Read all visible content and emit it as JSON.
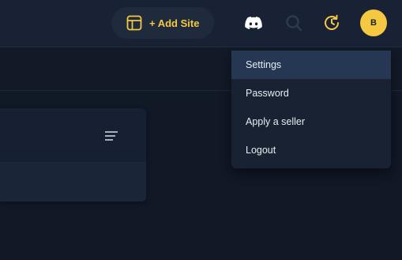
{
  "header": {
    "add_site_label": "+ Add Site",
    "avatar_initial": "B",
    "accent_color": "#f5c842"
  },
  "icons": {
    "add_site": "layout-icon",
    "discord": "discord-icon",
    "search": "search-icon",
    "history": "history-icon",
    "card_menu": "menu-lines-icon"
  },
  "dropdown": {
    "items": [
      {
        "label": "Settings",
        "active": true
      },
      {
        "label": "Password"
      },
      {
        "label": "Apply a seller"
      },
      {
        "label": "Logout"
      }
    ]
  }
}
